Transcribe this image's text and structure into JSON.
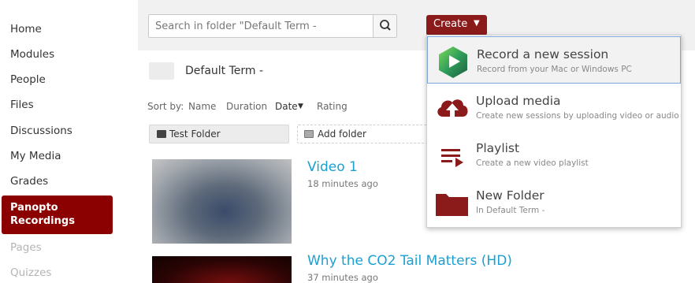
{
  "sidebar": {
    "items": [
      {
        "label": "Home"
      },
      {
        "label": "Modules"
      },
      {
        "label": "People"
      },
      {
        "label": "Files"
      },
      {
        "label": "Discussions"
      },
      {
        "label": "My Media"
      },
      {
        "label": "Grades"
      },
      {
        "label_line1": "Panopto",
        "label_line2": "Recordings"
      },
      {
        "label": "Pages"
      },
      {
        "label": "Quizzes"
      }
    ]
  },
  "search": {
    "placeholder": "Search in folder \"Default Term -"
  },
  "create": {
    "label": "Create",
    "caret": "▼"
  },
  "folder": {
    "title": "Default Term -"
  },
  "sort": {
    "label": "Sort by:",
    "options": [
      "Name",
      "Duration",
      "Date",
      "Rating"
    ],
    "selected_caret": "▼"
  },
  "subfolders": {
    "test_folder": "Test Folder",
    "add_folder": "Add folder"
  },
  "videos": [
    {
      "title": "Video 1",
      "meta": "18 minutes ago"
    },
    {
      "title": "Why the CO2 Tail Matters (HD)",
      "meta": "37 minutes ago"
    }
  ],
  "menu": {
    "items": [
      {
        "title": "Record a new session",
        "subtitle": "Record from your Mac or Windows PC",
        "icon": "panopto-logo-icon"
      },
      {
        "title": "Upload media",
        "subtitle": "Create new sessions by uploading video or audio",
        "icon": "cloud-upload-icon"
      },
      {
        "title": "Playlist",
        "subtitle": "Create a new video playlist",
        "icon": "playlist-icon"
      },
      {
        "title": "New Folder",
        "subtitle": "In Default Term -",
        "icon": "folder-icon"
      }
    ]
  },
  "colors": {
    "accent": "#8b0000",
    "link": "#1aa0d2",
    "menu_icon": "#8b1a1a"
  }
}
